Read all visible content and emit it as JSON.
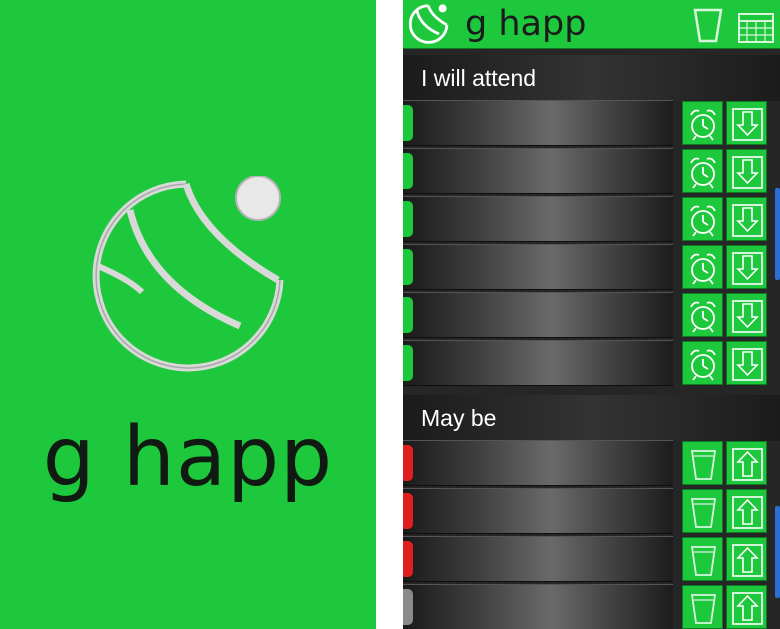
{
  "splash": {
    "title": "g happ",
    "logo_icon": "ball-moon-logo-icon",
    "background": "#1ec83c"
  },
  "app": {
    "header": {
      "title": "g happ",
      "logo_icon": "ball-moon-logo-icon",
      "icons": [
        "cup-icon",
        "calendar-icon"
      ],
      "background": "#1ec83c"
    },
    "sections": [
      {
        "label": "I will attend",
        "rows": [
          {
            "status_color": "#1ec83c",
            "actions": [
              "alarm-clock-icon",
              "download-arrow-icon"
            ]
          },
          {
            "status_color": "#1ec83c",
            "actions": [
              "alarm-clock-icon",
              "download-arrow-icon"
            ]
          },
          {
            "status_color": "#1ec83c",
            "actions": [
              "alarm-clock-icon",
              "download-arrow-icon"
            ]
          },
          {
            "status_color": "#1ec83c",
            "actions": [
              "alarm-clock-icon",
              "download-arrow-icon"
            ]
          },
          {
            "status_color": "#1ec83c",
            "actions": [
              "alarm-clock-icon",
              "download-arrow-icon"
            ]
          },
          {
            "status_color": "#1ec83c",
            "actions": [
              "alarm-clock-icon",
              "download-arrow-icon"
            ]
          }
        ]
      },
      {
        "label": "May be",
        "rows": [
          {
            "status_color": "#e02020",
            "actions": [
              "cup-icon",
              "upload-arrow-icon"
            ]
          },
          {
            "status_color": "#e02020",
            "actions": [
              "cup-icon",
              "upload-arrow-icon"
            ]
          },
          {
            "status_color": "#e02020",
            "actions": [
              "cup-icon",
              "upload-arrow-icon"
            ]
          },
          {
            "status_color": "#8a8a8a",
            "actions": [
              "cup-icon",
              "upload-arrow-icon"
            ]
          }
        ]
      }
    ],
    "scrollbar_color": "#2a6fd6"
  }
}
